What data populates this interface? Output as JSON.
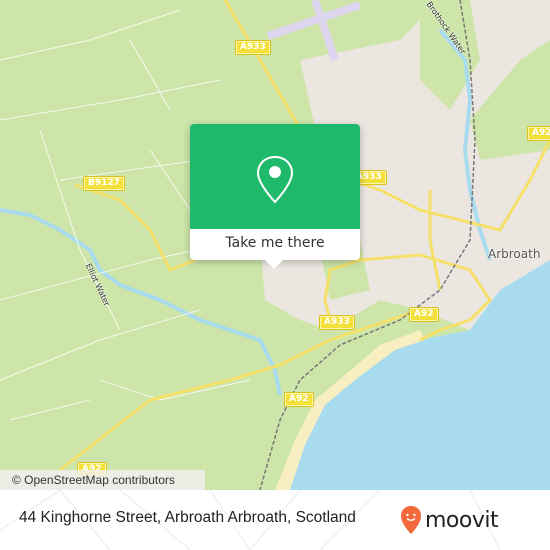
{
  "map": {
    "colors": {
      "land": "#cde5a8",
      "urban": "#ece6e1",
      "water": "#a9dbef",
      "sand": "#f7eec2",
      "major_road": "#f5e06a",
      "railway": "#777777",
      "airfield": "#ddd6ee",
      "minor_road": "#ffffff"
    },
    "road_labels": [
      "A933",
      "A92",
      "B9127",
      "A933",
      "A933",
      "A92",
      "A92",
      "A92"
    ],
    "place_labels": [
      "Arbroath"
    ],
    "water_labels": [
      "Elliot Water",
      "Brothock Water"
    ],
    "attribution": "© OpenStreetMap contributors"
  },
  "popup": {
    "icon": "map-pin-icon",
    "label": "Take me there",
    "color": "#1fb96b"
  },
  "footer": {
    "address": "44 Kinghorne Street, Arbroath Arbroath, Scotland",
    "brand": "moovit",
    "brand_color": "#f26a3c"
  }
}
